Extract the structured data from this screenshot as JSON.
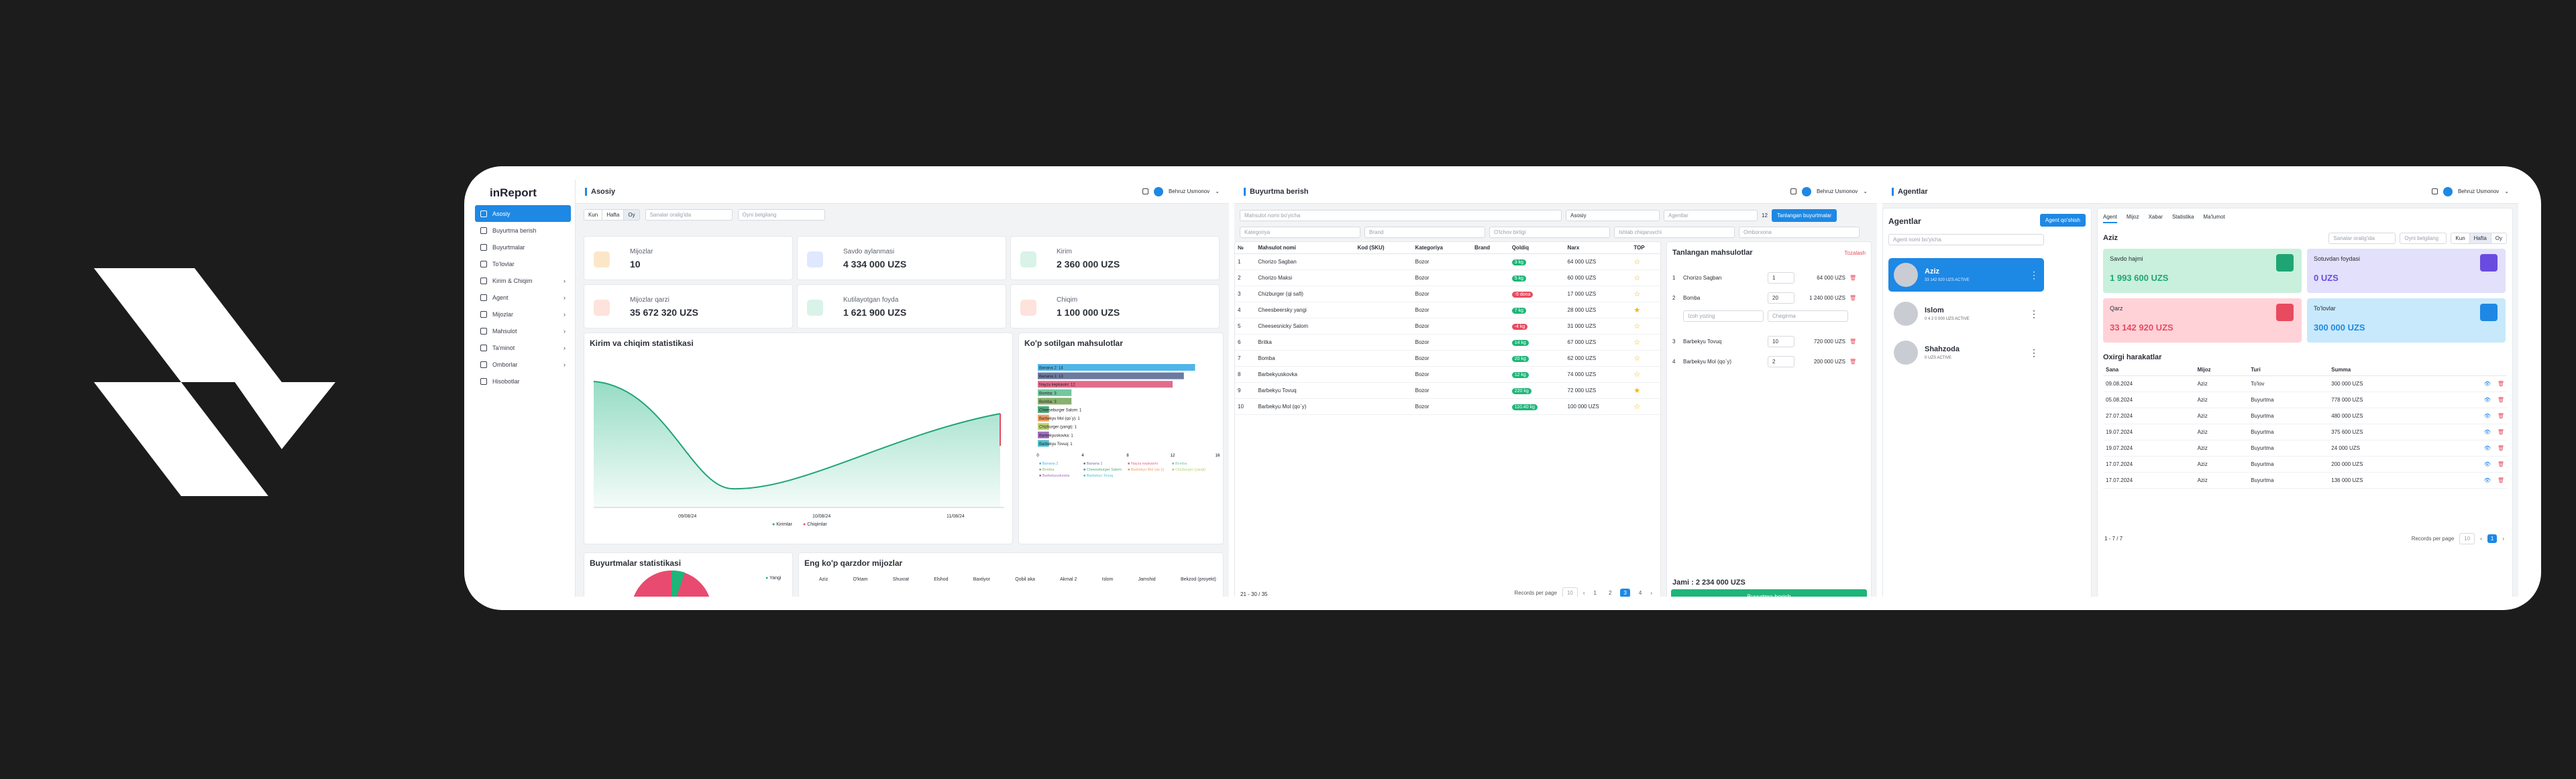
{
  "sidebar": {
    "brand": "inReport",
    "items": [
      {
        "label": "Asosiy"
      },
      {
        "label": "Buyurtma berish"
      },
      {
        "label": "Buyurtmalar"
      },
      {
        "label": "To'lovlar"
      },
      {
        "label": "Kirim & Chiqim"
      },
      {
        "label": "Agent"
      },
      {
        "label": "Mijozlar"
      },
      {
        "label": "Mahsulot"
      },
      {
        "label": "Ta'minot"
      },
      {
        "label": "Omborlar"
      },
      {
        "label": "Hisobotlar"
      }
    ]
  },
  "user": {
    "name": "Behruz Usmonov"
  },
  "p1": {
    "title": "Asosiy",
    "filters": {
      "day": "Kun",
      "week": "Hafta",
      "month": "Oy",
      "date_placeholder": "Sanalar oralig'ida",
      "search_placeholder": "Oyni belgilang"
    },
    "stats": [
      {
        "label": "Mijozlar",
        "value": "10"
      },
      {
        "label": "Savdo aylanmasi",
        "value": "4 334 000 UZS"
      },
      {
        "label": "Kirim",
        "value": "2 360 000 UZS"
      },
      {
        "label": "Mijozlar qarzi",
        "value": "35 672 320 UZS"
      },
      {
        "label": "Kutilayotgan foyda",
        "value": "1 621 900 UZS"
      },
      {
        "label": "Chiqim",
        "value": "1 100 000 UZS"
      }
    ],
    "kirim_title": "Kirim va chiqim statistikasi",
    "kirim_legend": [
      "Kirimlar",
      "Chiqimlar"
    ],
    "kirim_x": [
      "09/08/24",
      "10/08/24",
      "11/08/24"
    ],
    "top_title": "Ko'p sotilgan mahsulotlar",
    "buy_title": "Buyurtmalar statistikasi",
    "buy_legend": "Yangi",
    "debt_title": "Eng ko'p qarzdor mijozlar",
    "debt_cols": [
      "Aziz",
      "O'ktam",
      "Shuxrat",
      "Elshod",
      "Baxtiyor",
      "Qobil aka",
      "Akmal 2",
      "Islom",
      "Jamshid",
      "Bekzod (proyekt)"
    ]
  },
  "chart_data": {
    "type": "bar",
    "orientation": "horizontal",
    "title": "Ko'p sotilgan mahsulotlar",
    "categories": [
      "Banana 2",
      "Banana 1",
      "Nayza kepkasini",
      "Bomba",
      "Bomba",
      "Cheeseburger Salom",
      "Barbekyu Mol (qo`y)",
      "Chizburger (yangi)",
      "Barbekyuskovka",
      "Barbekyu Tovuq"
    ],
    "values": [
      14,
      13,
      12,
      3,
      3,
      1,
      1,
      1,
      1,
      1
    ],
    "series_colors": [
      "#4fb5e8",
      "#6c7aa0",
      "#e06c8c",
      "#73c6a0",
      "#8ab06c",
      "#4fa880",
      "#f0a060",
      "#b8d070",
      "#a070c0",
      "#50c0d0"
    ],
    "xlim": [
      0,
      16
    ],
    "xticks": [
      "0",
      "4",
      "8",
      "12",
      "16"
    ],
    "legend": [
      "Banana 2",
      "Banana 1",
      "Nayza kepkasini",
      "Bomba",
      "Bomba",
      "Cheeseburger Salom",
      "Barbekyu Mol (qo`y)",
      "Chizburger (yangi)",
      "Barbekyuskovka",
      "Barbekyu Tovuq"
    ]
  },
  "p2": {
    "title": "Buyurtma berish",
    "search_placeholder": "Mahsulot nomi bo'yicha",
    "ombor": "Asosiy",
    "agent": "Agentlar",
    "kurs": "12",
    "new_btn": "Tanlangan buyurtmalar",
    "filter_ph": [
      "Kategoriya",
      "Brand",
      "O'lchov birligi",
      "Ishlab chiqaruvchi",
      "Omborxona"
    ],
    "cols": [
      "№",
      "Mahsulot nomi",
      "Kod (SKU)",
      "Kategoriya",
      "Brand",
      "Qoldiq",
      "Narx",
      "TOP"
    ],
    "rows": [
      {
        "n": "1",
        "name": "Chorizo Sagban",
        "cat": "Bozor",
        "qty": "3 kg",
        "price": "64 000 UZS",
        "c": "#1fb57a",
        "top": "☆"
      },
      {
        "n": "2",
        "name": "Chorizo Maksi",
        "cat": "Bozor",
        "qty": "5 kg",
        "price": "60 000 UZS",
        "c": "#1fb57a",
        "top": "☆"
      },
      {
        "n": "3",
        "name": "Chizburger (qi safi)",
        "cat": "Bozor",
        "qty": "-5 dona",
        "price": "17 000 UZS",
        "c": "#e84b5f",
        "top": "☆"
      },
      {
        "n": "4",
        "name": "Cheesbeersky yangi",
        "cat": "Bozor",
        "qty": "7 kg",
        "price": "28 000 UZS",
        "c": "#1fb57a",
        "top": "★"
      },
      {
        "n": "5",
        "name": "Cheesesnicky Salom",
        "cat": "Bozor",
        "qty": "-4 kg",
        "price": "31 000 UZS",
        "c": "#e84b5f",
        "top": "☆"
      },
      {
        "n": "6",
        "name": "Britka",
        "cat": "Bozor",
        "qty": "14 kg",
        "price": "67 000 UZS",
        "c": "#1fb57a",
        "top": "☆"
      },
      {
        "n": "7",
        "name": "Bomba",
        "cat": "Bozor",
        "qty": "20 kg",
        "price": "62 000 UZS",
        "c": "#1fb57a",
        "top": "☆"
      },
      {
        "n": "8",
        "name": "Barbekyuskovka",
        "cat": "Bozor",
        "qty": "12 kg",
        "price": "74 000 UZS",
        "c": "#1fb57a",
        "top": "☆"
      },
      {
        "n": "9",
        "name": "Barbekyu Tovuq",
        "cat": "Bozor",
        "qty": "220 kg",
        "price": "72 000 UZS",
        "c": "#1fb57a",
        "top": "★"
      },
      {
        "n": "10",
        "name": "Barbekyu Mol (qo`y)",
        "cat": "Bozor",
        "qty": "110.40 kg",
        "price": "100 000 UZS",
        "c": "#1fb57a",
        "top": "☆"
      }
    ],
    "records": "21 - 30 / 35",
    "rpp_label": "Records per page",
    "rpp": "10",
    "pages": [
      "1",
      "2",
      "3",
      "4"
    ],
    "cart_title": "Tanlangan mahsulotlar",
    "clear": "Tozalash",
    "cart": [
      {
        "n": "1",
        "name": "Chorizo Sagban",
        "q": "1",
        "p": "64 000 UZS"
      },
      {
        "n": "2",
        "name": "Bomba",
        "q": "20",
        "p": "1 240 000 UZS"
      },
      {
        "n": "3",
        "name": "Barbekyu Tovuq",
        "q": "10",
        "p": "720 000 UZS"
      },
      {
        "n": "4",
        "name": "Barbekyu Mol (qo`y)",
        "q": "2",
        "p": "200 000 UZS"
      }
    ],
    "cart_ph1": "Izoh yozing",
    "cart_ph2": "Chegirma",
    "total": "Jami : 2 234 000 UZS",
    "order_btn": "Buyurtma berish"
  },
  "p3": {
    "title": "Agentlar",
    "header": "Agentlar",
    "new_btn": "Agent qo'shish",
    "search_placeholder": "Agent nomi bo'yicha",
    "agents": [
      {
        "name": "Aziz",
        "meta": "33 142 920 UZS  ACTIVE"
      },
      {
        "name": "Islom",
        "meta": "0 4 2 0 000 UZS  ACTIVE"
      },
      {
        "name": "Shahzoda",
        "meta": "0 UZS  ACTIVE"
      }
    ],
    "tabs": [
      "Agent",
      "Mijoz",
      "Xabar",
      "Statistika",
      "Ma'lumot"
    ],
    "sel": "Aziz",
    "date_placeholder": "Sanalar oralig'ida",
    "month_placeholder": "Oyni belgilang",
    "cards": [
      {
        "label": "Savdo hajmi",
        "value": "1 993 600 UZS"
      },
      {
        "label": "Sotuvdan foydasi",
        "value": "0 UZS"
      },
      {
        "label": "Qarz",
        "value": "33 142 920 UZS"
      },
      {
        "label": "To'lovlar",
        "value": "300 000 UZS"
      }
    ],
    "moves_title": "Oxirgi harakatlar",
    "moves_cols": [
      "Sana",
      "Mijoz",
      "Turi",
      "Summa"
    ],
    "moves": [
      {
        "d": "09.08.2024",
        "m": "Aziz",
        "t": "To'lov",
        "s": "300 000 UZS"
      },
      {
        "d": "05.08.2024",
        "m": "Aziz",
        "t": "Buyurtma",
        "s": "778 000 UZS"
      },
      {
        "d": "27.07.2024",
        "m": "Aziz",
        "t": "Buyurtma",
        "s": "480 000 UZS"
      },
      {
        "d": "19.07.2024",
        "m": "Aziz",
        "t": "Buyurtma",
        "s": "375 600 UZS"
      },
      {
        "d": "19.07.2024",
        "m": "Aziz",
        "t": "Buyurtma",
        "s": "24 000 UZS"
      },
      {
        "d": "17.07.2024",
        "m": "Aziz",
        "t": "Buyurtma",
        "s": "200 000 UZS"
      },
      {
        "d": "17.07.2024",
        "m": "Aziz",
        "t": "Buyurtma",
        "s": "136 000 UZS"
      }
    ],
    "pager": "1 - 7 / 7",
    "rpp_label": "Records per page",
    "rpp": "10",
    "page": "1"
  }
}
